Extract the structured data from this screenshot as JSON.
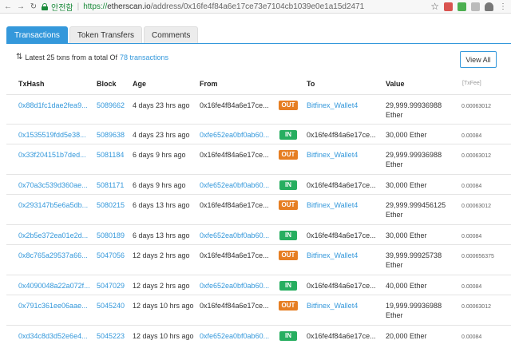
{
  "browser": {
    "secure_label": "안전함",
    "url_protocol": "https://",
    "url_host": "etherscan.io",
    "url_path": "/address/0x16fe4f84a6e17ce73e7104cb1039e0e1a15d2471"
  },
  "tabs": [
    {
      "label": "Transactions",
      "active": true
    },
    {
      "label": "Token Transfers",
      "active": false
    },
    {
      "label": "Comments",
      "active": false
    }
  ],
  "summary": {
    "prefix": "Latest 25 txns from a total Of",
    "link": "78 transactions"
  },
  "view_all_label": "View All",
  "columns": [
    "TxHash",
    "Block",
    "Age",
    "From",
    "To",
    "Value",
    "[TxFee]"
  ],
  "rows": [
    {
      "hash": "0x88d1fc1dae2fea9...",
      "block": "5089662",
      "age": "4 days 23 hrs ago",
      "from": "0x16fe4f84a6e17ce...",
      "dir": "OUT",
      "to": "Bitfinex_Wallet4",
      "value": "29,999.99936988 Ether",
      "fee": "0.00063012"
    },
    {
      "hash": "0x1535519fdd5e38...",
      "block": "5089638",
      "age": "4 days 23 hrs ago",
      "from": "0xfe652ea0bf0ab60...",
      "dir": "IN",
      "to": "0x16fe4f84a6e17ce...",
      "value": "30,000 Ether",
      "fee": "0.00084"
    },
    {
      "hash": "0x33f204151b7ded...",
      "block": "5081184",
      "age": "6 days 9 hrs ago",
      "from": "0x16fe4f84a6e17ce...",
      "dir": "OUT",
      "to": "Bitfinex_Wallet4",
      "value": "29,999.99936988 Ether",
      "fee": "0.00063012"
    },
    {
      "hash": "0x70a3c539d360ae...",
      "block": "5081171",
      "age": "6 days 9 hrs ago",
      "from": "0xfe652ea0bf0ab60...",
      "dir": "IN",
      "to": "0x16fe4f84a6e17ce...",
      "value": "30,000 Ether",
      "fee": "0.00084"
    },
    {
      "hash": "0x293147b5e6a5db...",
      "block": "5080215",
      "age": "6 days 13 hrs ago",
      "from": "0x16fe4f84a6e17ce...",
      "dir": "OUT",
      "to": "Bitfinex_Wallet4",
      "value": "29,999.999456125 Ether",
      "fee": "0.00063012"
    },
    {
      "hash": "0x2b5e372ea01e2d...",
      "block": "5080189",
      "age": "6 days 13 hrs ago",
      "from": "0xfe652ea0bf0ab60...",
      "dir": "IN",
      "to": "0x16fe4f84a6e17ce...",
      "value": "30,000 Ether",
      "fee": "0.00084"
    },
    {
      "hash": "0x8c765a29537a66...",
      "block": "5047056",
      "age": "12 days 2 hrs ago",
      "from": "0x16fe4f84a6e17ce...",
      "dir": "OUT",
      "to": "Bitfinex_Wallet4",
      "value": "39,999.99925738 Ether",
      "fee": "0.000656375"
    },
    {
      "hash": "0x4090048a22a072f...",
      "block": "5047029",
      "age": "12 days 2 hrs ago",
      "from": "0xfe652ea0bf0ab60...",
      "dir": "IN",
      "to": "0x16fe4f84a6e17ce...",
      "value": "40,000 Ether",
      "fee": "0.00084"
    },
    {
      "hash": "0x791c361ee06aae...",
      "block": "5045240",
      "age": "12 days 10 hrs ago",
      "from": "0x16fe4f84a6e17ce...",
      "dir": "OUT",
      "to": "Bitfinex_Wallet4",
      "value": "19,999.99936988 Ether",
      "fee": "0.00063012"
    },
    {
      "hash": "0xd34c8d3d52e6e4...",
      "block": "5045223",
      "age": "12 days 10 hrs ago",
      "from": "0xfe652ea0bf0ab60...",
      "dir": "IN",
      "to": "0x16fe4f84a6e17ce...",
      "value": "20,000 Ether",
      "fee": "0.00084"
    }
  ]
}
